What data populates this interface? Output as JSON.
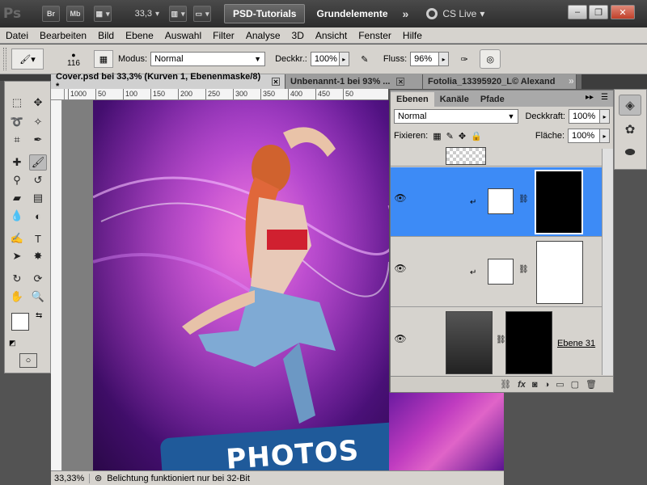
{
  "appbar": {
    "logo": "Ps",
    "bridge_label": "Br",
    "minibridge_label": "Mb",
    "zoom_value": "33,3",
    "workspace_active": "PSD-Tutorials",
    "workspace_other": "Grundelemente",
    "more_label": "»",
    "cslive_label": "CS Live"
  },
  "menu": [
    "Datei",
    "Bearbeiten",
    "Bild",
    "Ebene",
    "Auswahl",
    "Filter",
    "Analyse",
    "3D",
    "Ansicht",
    "Fenster",
    "Hilfe"
  ],
  "options": {
    "brush_size": "116",
    "modus_label": "Modus:",
    "modus_value": "Normal",
    "opacity_label": "Deckkr.:",
    "opacity_value": "100%",
    "flow_label": "Fluss:",
    "flow_value": "96%"
  },
  "tabs": [
    {
      "label": "Cover.psd bei 33,3% (Kurven 1, Ebenenmaske/8) *",
      "active": true
    },
    {
      "label": "Unbenannt-1 bei 93% ...",
      "active": false
    },
    {
      "label": "Fotolia_13395920_L© Alexand",
      "active": false
    }
  ],
  "tabs_more": "»",
  "ruler_ticks": [
    "1000",
    "50",
    "100",
    "150",
    "200",
    "250",
    "300",
    "350",
    "400",
    "450",
    "50"
  ],
  "layers_panel": {
    "tabs": [
      "Ebenen",
      "Kanäle",
      "Pfade"
    ],
    "blend_mode": "Normal",
    "opacity_label": "Deckkraft:",
    "opacity_value": "100%",
    "lock_label": "Fixieren:",
    "fill_label": "Fläche:",
    "fill_value": "100%",
    "layer_name": "Ebene 31",
    "menu_label": "▸▸"
  },
  "canvas": {
    "banner_text": "PHOTOS"
  },
  "status": {
    "zoom": "33,33%",
    "info": "Belichtung funktioniert nur bei 32-Bit"
  },
  "colors": {
    "selected_layer": "#3d8bf6",
    "app_dark": "#535353",
    "ui_light": "#d6d3ce"
  }
}
